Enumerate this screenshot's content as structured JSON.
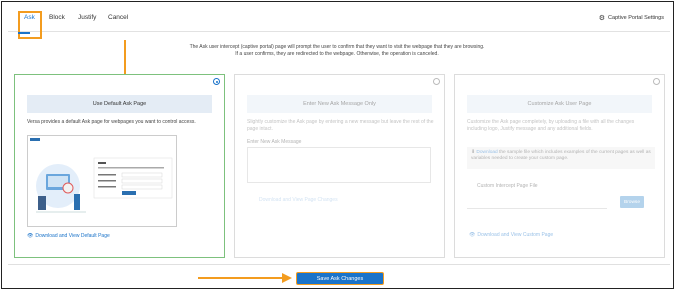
{
  "tabs": [
    {
      "label": "Ask"
    },
    {
      "label": "Block"
    },
    {
      "label": "Justify"
    },
    {
      "label": "Cancel"
    }
  ],
  "captive_settings_label": "Captive Portal Settings",
  "description": {
    "line1": "The Ask user intercept (captive portal) page will prompt the user to confirm that they want to visit the webpage that they are browsing.",
    "line2": "If a user confirms, they are redirected to the webpage. Otherwise, the operation is canceled."
  },
  "cards": {
    "default": {
      "title": "Use Default Ask Page",
      "text": "Versa provides a default Ask page for webpages you want to control access.",
      "link": "Download and View Default Page",
      "selected": true
    },
    "message": {
      "title": "Enter New Ask Message Only",
      "text": "Slightly customize the Ask page by entering a new message but leave the rest of the page intact.",
      "field_label": "Enter New Ask Message",
      "link": "Download and View Page Changes",
      "selected": false
    },
    "custom": {
      "title": "Customize Ask User Page",
      "text": "Customize the Ask page completely, by uploading a file with all the changes including logo, Justify message and any additional fields.",
      "download_word": "Download",
      "download_text": " the sample file which includes examples of the current pages as well as variables needed to create your custom page.",
      "file_label": "Custom Intercept Page File",
      "browse_label": "Browse",
      "link": "Download and View Custom Page",
      "selected": false
    }
  },
  "save_label": "Save Ask Changes",
  "colors": {
    "accent": "#1a73c9",
    "annotation": "#f39c1f",
    "selected_border": "#7dc17d",
    "card_header": "#e4ecf5"
  }
}
